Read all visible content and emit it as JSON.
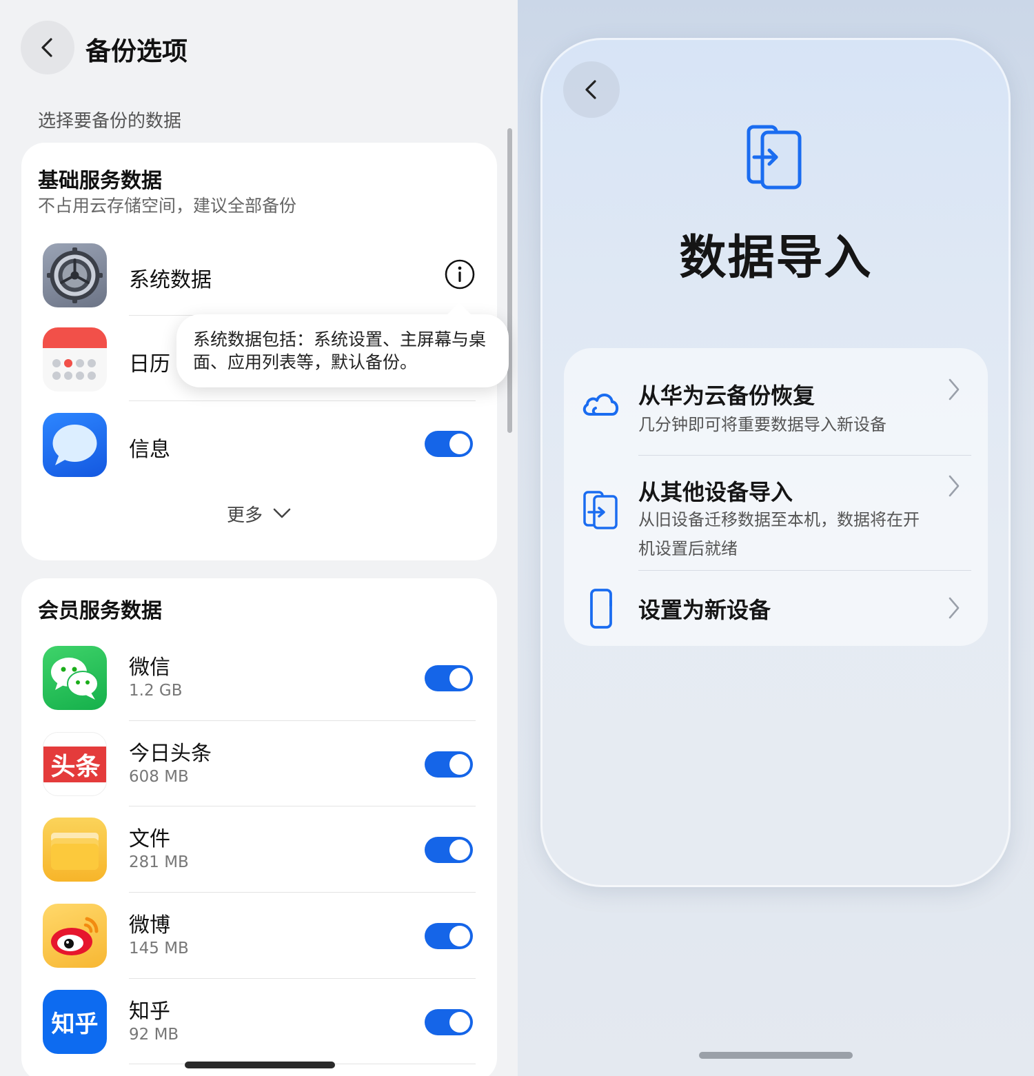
{
  "left": {
    "title": "备份选项",
    "caption": "选择要备份的数据",
    "basic": {
      "heading": "基础服务数据",
      "subtitle": "不占用云存储空间，建议全部备份",
      "items": [
        {
          "name": "系统数据",
          "icon": "settings-gear-icon"
        },
        {
          "name": "日历",
          "icon": "calendar-icon"
        },
        {
          "name": "信息",
          "icon": "message-bubble-icon",
          "enabled": true
        }
      ],
      "more_label": "更多",
      "tooltip": "系统数据包括：系统设置、主屏幕与桌面、应用列表等，默认备份。"
    },
    "member": {
      "heading": "会员服务数据",
      "items": [
        {
          "name": "微信",
          "size": "1.2 GB",
          "enabled": true,
          "icon": "wechat-icon",
          "color": "#1aad19"
        },
        {
          "name": "今日头条",
          "size": "608 MB",
          "enabled": true,
          "icon": "toutiao-icon",
          "badge": "头条",
          "color": "#e43b3b"
        },
        {
          "name": "文件",
          "size": "281 MB",
          "enabled": true,
          "icon": "files-folder-icon",
          "color": "#f9c13a"
        },
        {
          "name": "微博",
          "size": "145 MB",
          "enabled": true,
          "icon": "weibo-icon",
          "color": "#f5a623"
        },
        {
          "name": "知乎",
          "size": "92 MB",
          "enabled": true,
          "icon": "zhihu-icon",
          "badge": "知乎",
          "color": "#0d6bf0"
        }
      ]
    }
  },
  "right": {
    "title": "数据导入",
    "options": [
      {
        "title": "从华为云备份恢复",
        "desc": "几分钟即可将重要数据导入新设备",
        "icon": "cloud-icon"
      },
      {
        "title": "从其他设备导入",
        "desc": "从旧设备迁移数据至本机，数据将在开机设置后就绪",
        "icon": "phone-transfer-icon"
      },
      {
        "title": "设置为新设备",
        "desc": "",
        "icon": "phone-icon"
      }
    ]
  },
  "colors": {
    "accent": "#1565e8",
    "icon_blue": "#1a6cf0"
  }
}
